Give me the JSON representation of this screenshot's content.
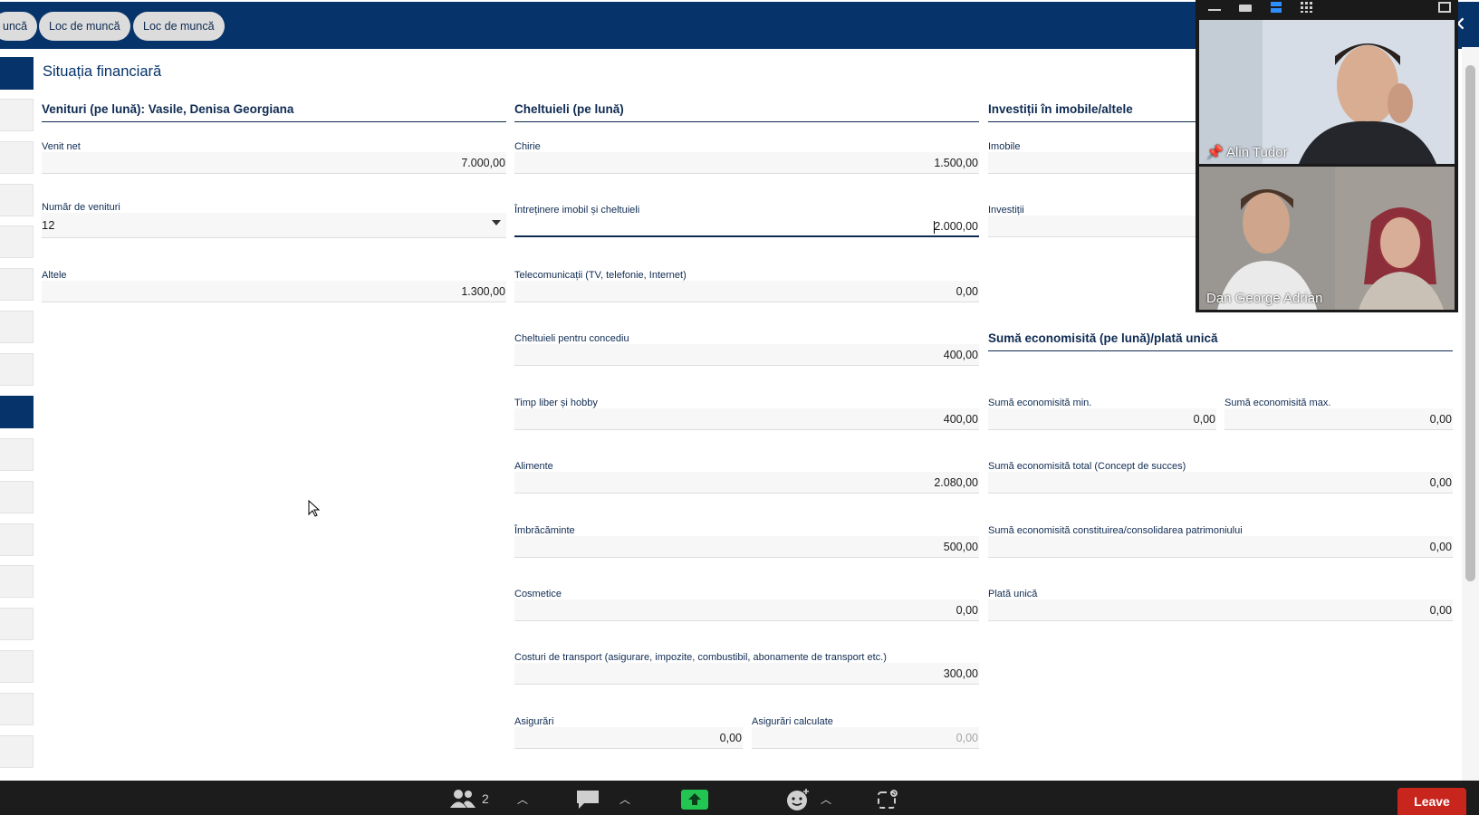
{
  "tabs": [
    "uncă",
    "Loc de muncă",
    "Loc de muncă"
  ],
  "page_title": "Situația financiară",
  "income": {
    "heading": "Venituri (pe lună): Vasile, Denisa Georgiana",
    "venit_net_label": "Venit net",
    "venit_net_value": "7.000,00",
    "numar_venituri_label": "Număr de venituri",
    "numar_venituri_value": "12",
    "altele_label": "Altele",
    "altele_value": "1.300,00"
  },
  "expenses": {
    "heading": "Cheltuieli (pe lună)",
    "chirie_label": "Chirie",
    "chirie_value": "1.500,00",
    "intretinere_label": "Întreținere imobil și cheltuieli",
    "intretinere_value": "2.000,00",
    "telecom_label": "Telecomunicații (TV, telefonie, Internet)",
    "telecom_value": "0,00",
    "concediu_label": "Cheltuieli pentru concediu",
    "concediu_value": "400,00",
    "hobby_label": "Timp liber și hobby",
    "hobby_value": "400,00",
    "alimente_label": "Alimente",
    "alimente_value": "2.080,00",
    "imbracaminte_label": "Îmbrăcăminte",
    "imbracaminte_value": "500,00",
    "cosmetice_label": "Cosmetice",
    "cosmetice_value": "0,00",
    "transport_label": "Costuri de transport (asigurare, impozite, combustibil, abonamente de transport etc.)",
    "transport_value": "300,00",
    "asigurari_label": "Asigurări",
    "asigurari_value": "0,00",
    "asigurari_calc_label": "Asigurări calculate",
    "asigurari_calc_value": "0,00"
  },
  "investments": {
    "heading": "Investiții în imobile/altele",
    "imobile_label": "Imobile",
    "investitii_label": "Investiții"
  },
  "savings": {
    "heading": "Sumă economisită (pe lună)/plată unică",
    "min_label": "Sumă economisită min.",
    "min_value": "0,00",
    "max_label": "Sumă economisită max.",
    "max_value": "0,00",
    "total_label": "Sumă economisită total (Concept de succes)",
    "total_value": "0,00",
    "patrimoniu_label": "Sumă economisită constituirea/consolidarea patrimoniului",
    "patrimoniu_value": "0,00",
    "plata_unica_label": "Plată unică",
    "plata_unica_value": "0,00"
  },
  "video": {
    "participant_1": "Alin Tudor",
    "participant_2": "Dan George Adrian"
  },
  "meeting_bar": {
    "participants_count": "2",
    "leave_label": "Leave"
  },
  "colors": {
    "primary": "#06336a",
    "text": "#0f2b52",
    "leave": "#c8251d"
  }
}
